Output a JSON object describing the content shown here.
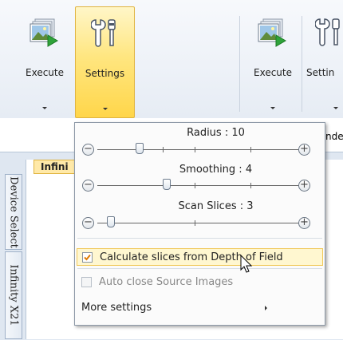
{
  "ribbon": {
    "buttons": [
      {
        "label": "Execute",
        "icon": "image-execute-icon"
      },
      {
        "label": "Settings",
        "icon": "settings-tools-icon",
        "active": true
      },
      {
        "label": "Execute",
        "icon": "image-execute-icon"
      },
      {
        "label": "Settin",
        "icon": "settings-tools-icon"
      }
    ],
    "partial_label": "nde"
  },
  "dock": {
    "tabs": [
      "Device Select",
      "Infinity X21"
    ],
    "document_tab": "Infini"
  },
  "popup": {
    "sliders": [
      {
        "label": "Radius : 10",
        "value": 10
      },
      {
        "label": "Smoothing : 4",
        "value": 4
      },
      {
        "label": "Scan Slices : 3",
        "value": 3
      }
    ],
    "items": [
      {
        "label": "Calculate slices from Depth of Field",
        "checked": true,
        "enabled": true,
        "highlighted": true
      },
      {
        "label": "Auto close Source Images",
        "checked": false,
        "enabled": false
      },
      {
        "label": "More settings",
        "submenu": true
      }
    ]
  },
  "colors": {
    "active_ribbon": "#ffd64a",
    "hover_item": "#fff7d0",
    "check_mark": "#e07a00"
  }
}
